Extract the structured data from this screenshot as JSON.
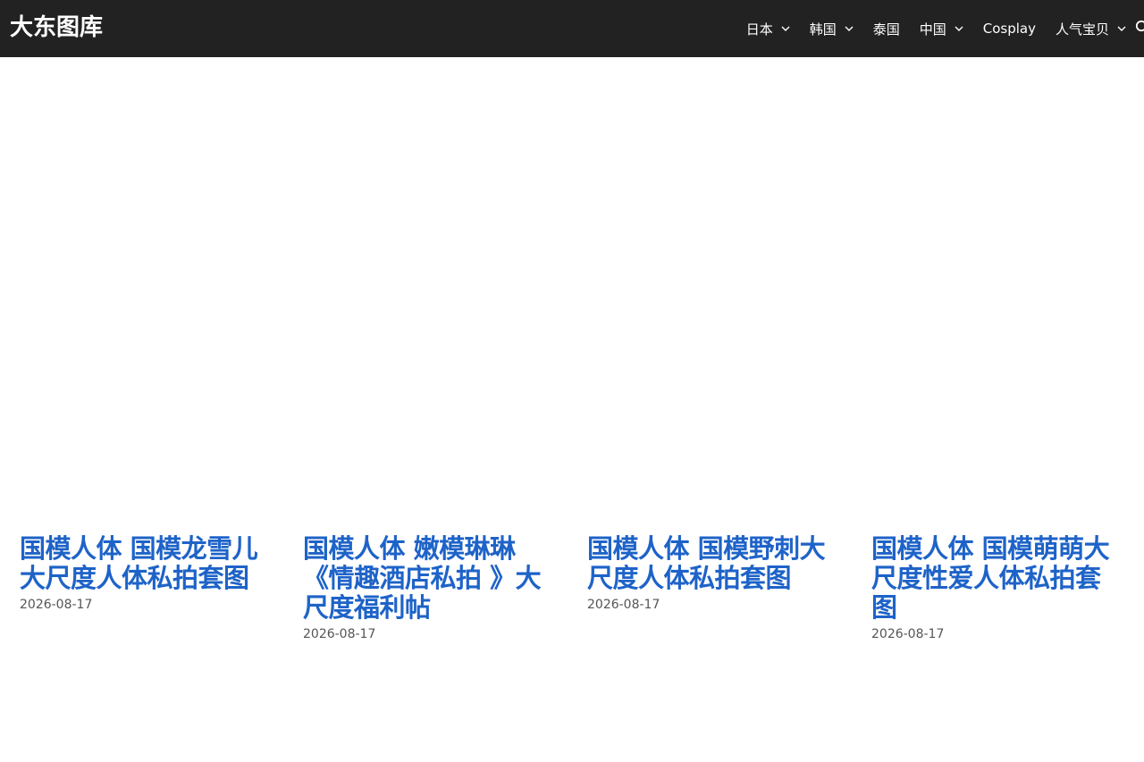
{
  "header": {
    "site_title": "大东图库",
    "nav": [
      {
        "label": "日本",
        "has_dropdown": true
      },
      {
        "label": "韩国",
        "has_dropdown": true
      },
      {
        "label": "泰国",
        "has_dropdown": false
      },
      {
        "label": "中国",
        "has_dropdown": true
      },
      {
        "label": "Cosplay",
        "has_dropdown": false
      },
      {
        "label": "人气宝贝",
        "has_dropdown": true
      }
    ],
    "search_icon": "search-icon"
  },
  "posts": [
    {
      "title": "国模人体 国模龙雪儿大尺度人体私拍套图",
      "date": "2026-08-17"
    },
    {
      "title": "国模人体 嫩模琳琳《情趣酒店私拍 》大尺度福利帖",
      "date": "2026-08-17"
    },
    {
      "title": "国模人体 国模野刺大尺度人体私拍套图",
      "date": "2026-08-17"
    },
    {
      "title": "国模人体 国模萌萌大尺度性爱人体私拍套图",
      "date": "2026-08-17"
    }
  ],
  "colors": {
    "header_bg": "#222222",
    "link": "#1e63c8",
    "date": "#555555"
  }
}
